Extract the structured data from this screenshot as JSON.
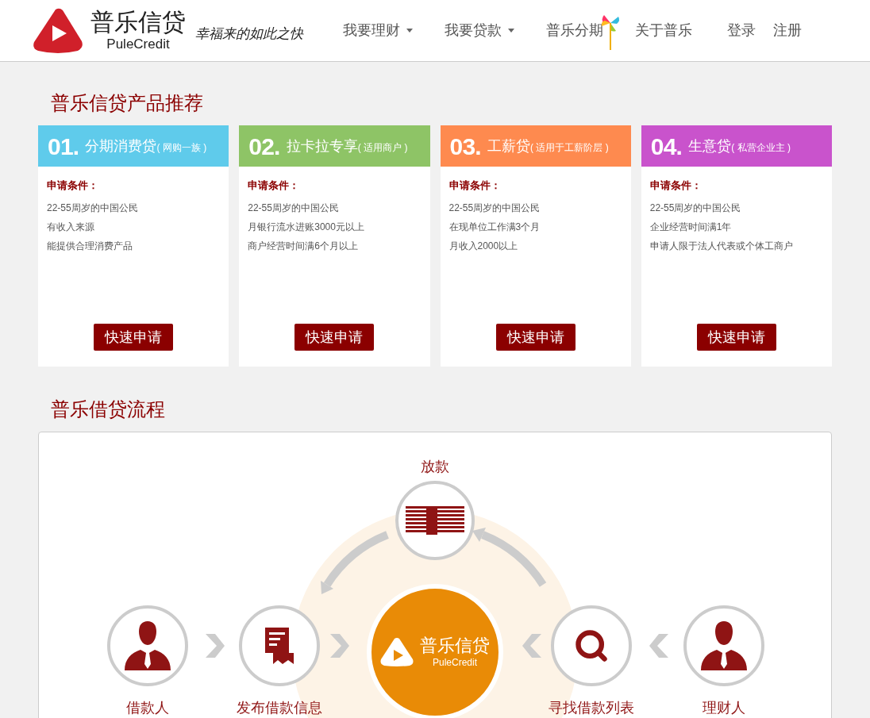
{
  "header": {
    "logo": {
      "name": "普乐信贷",
      "subtitle": "PuleCredit",
      "slogan": "幸福来的如此之快"
    },
    "nav": [
      {
        "label": "我要理财",
        "kind": "dropdown"
      },
      {
        "label": "我要贷款",
        "kind": "dropdown"
      },
      {
        "label": "普乐分期",
        "kind": "pinwheel"
      },
      {
        "label": "关于普乐",
        "kind": "plain"
      }
    ],
    "auth": [
      "登录",
      "注册"
    ]
  },
  "products": {
    "title": "普乐信贷产品推荐",
    "cards": [
      {
        "number": "01.",
        "name": "分期消费贷",
        "note": "( 网购一族 )",
        "color": "#5fcbeb",
        "conditions_label": "申请条件：",
        "conditions": [
          "22-55周岁的中国公民",
          "有收入来源",
          "能提供合理消费产品"
        ],
        "button": "快速申请"
      },
      {
        "number": "02.",
        "name": "拉卡拉专享",
        "note": "( 适用商户 )",
        "color": "#8ec466",
        "conditions_label": "申请条件：",
        "conditions": [
          "22-55周岁的中国公民",
          "月银行流水进账3000元以上",
          "商户经营时间满6个月以上"
        ],
        "button": "快速申请"
      },
      {
        "number": "03.",
        "name": "工薪贷",
        "note": "( 适用于工薪阶层 )",
        "color": "#fe8a4f",
        "conditions_label": "申请条件：",
        "conditions": [
          "22-55周岁的中国公民",
          "在现单位工作满3个月",
          "月收入2000以上"
        ],
        "button": "快速申请"
      },
      {
        "number": "04.",
        "name": "生意贷",
        "note": "( 私营企业主 )",
        "color": "#c953cc",
        "conditions_label": "申请条件：",
        "conditions": [
          "22-55周岁的中国公民",
          "企业经营时间满1年",
          "申请人限于法人代表或个体工商户"
        ],
        "button": "快速申请"
      }
    ]
  },
  "process": {
    "title": "普乐借贷流程",
    "top_label": "放款",
    "center": {
      "name": "普乐信贷",
      "subtitle": "PuleCredit"
    },
    "steps": [
      {
        "label": "借款人",
        "kind": "person"
      },
      {
        "label": "发布借款信息",
        "kind": "document"
      },
      {
        "label": "寻找借款列表",
        "kind": "search"
      },
      {
        "label": "理财人",
        "kind": "person"
      }
    ]
  }
}
